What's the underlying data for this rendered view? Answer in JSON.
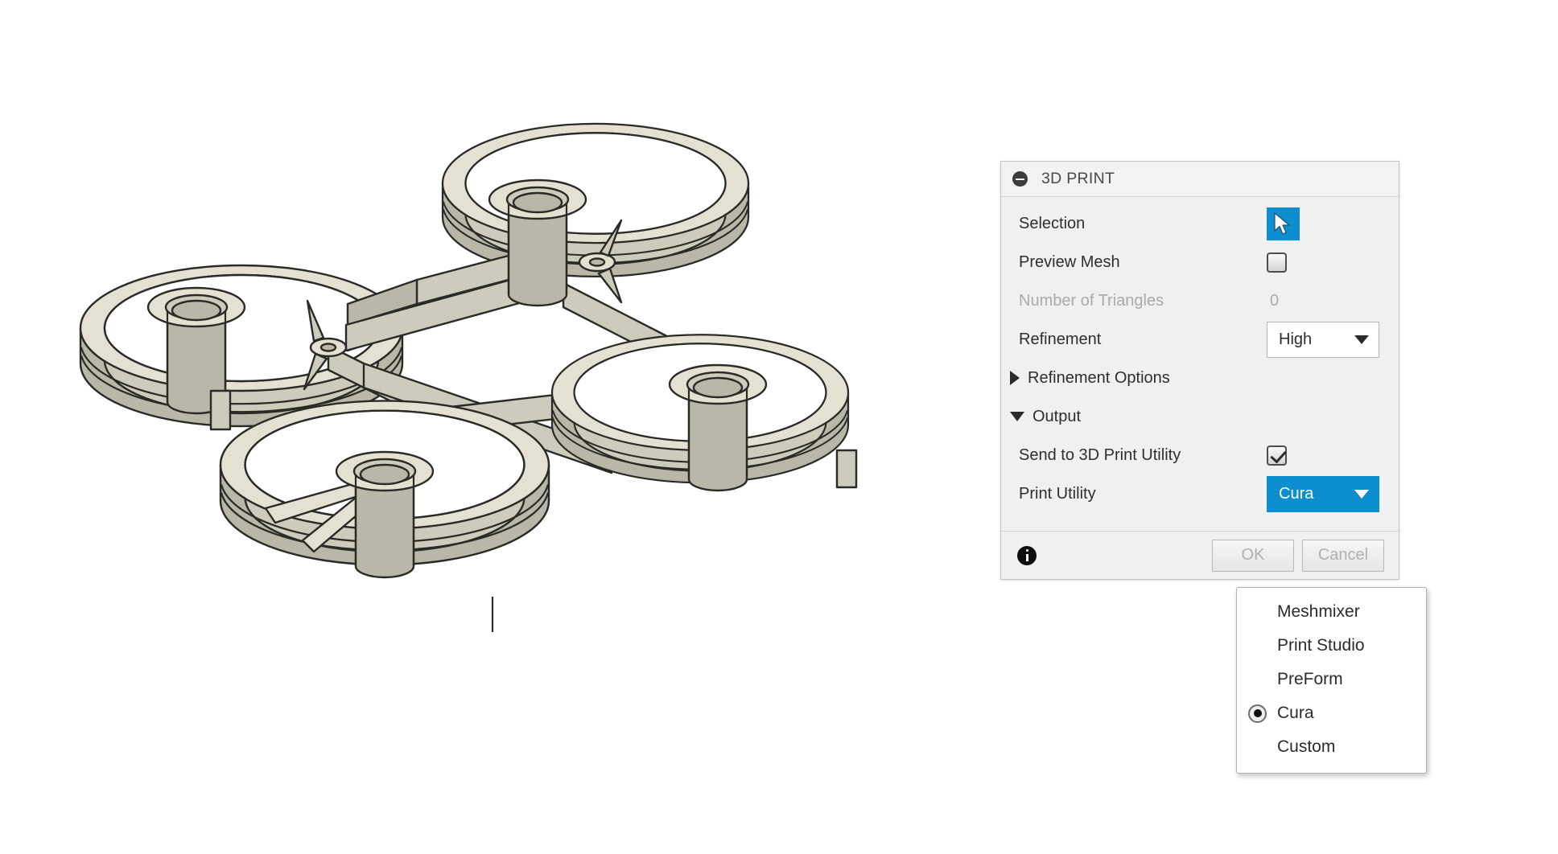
{
  "viewport": {
    "name": "3d-model-viewport",
    "model": "quadcopter ducted drone frame",
    "background_color": "#ffffff",
    "model_fill": "#cdcbbc",
    "model_highlight": "#e3e0d2",
    "model_shadow": "#b9b7a8",
    "model_outline": "#2a2a26"
  },
  "panel": {
    "title": "3D PRINT",
    "collapse_icon": "circle-minus-icon",
    "accent_color": "#0d8ecf",
    "rows": {
      "selection": {
        "label": "Selection",
        "control": "cursor-arrow-button",
        "active": true
      },
      "preview_mesh": {
        "label": "Preview Mesh",
        "checked": false
      },
      "number_of_triangles": {
        "label": "Number of Triangles",
        "value": "0",
        "disabled": true
      },
      "refinement": {
        "label": "Refinement",
        "value": "High",
        "options": [
          "High"
        ]
      },
      "refinement_options": {
        "label": "Refinement Options",
        "expanded": false,
        "triangle": "triangle-right-icon"
      },
      "output": {
        "label": "Output",
        "expanded": true,
        "triangle": "triangle-down-icon"
      },
      "send_to_3d_print_utility": {
        "label": "Send to 3D Print Utility",
        "checked": true
      },
      "print_utility": {
        "label": "Print Utility",
        "value": "Cura"
      }
    },
    "footer": {
      "info_icon": "info-icon",
      "ok_label": "OK",
      "cancel_label": "Cancel"
    }
  },
  "popup_menu": {
    "name": "print-utility-menu",
    "items": [
      {
        "label": "Meshmixer",
        "selected": false
      },
      {
        "label": "Print Studio",
        "selected": false
      },
      {
        "label": "PreForm",
        "selected": false
      },
      {
        "label": "Cura",
        "selected": true
      },
      {
        "label": "Custom",
        "selected": false
      }
    ]
  }
}
